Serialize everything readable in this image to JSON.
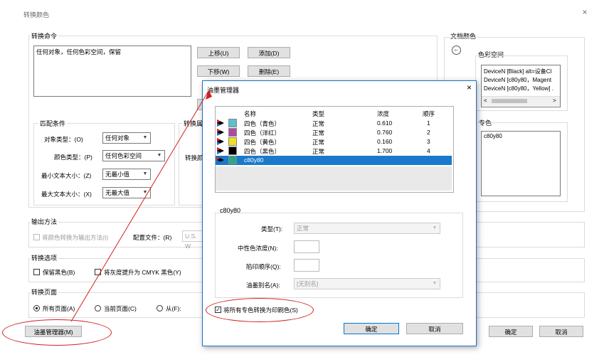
{
  "window": {
    "title": "转换颜色",
    "close_glyph": "×"
  },
  "commands": {
    "group_label": "转换命令",
    "list_items": [
      "任何对象，任何色彩空间，保留"
    ],
    "move_up": "上移(U)",
    "add": "添加(D)",
    "move_down": "下移(W)",
    "delete": "删除(E)"
  },
  "match": {
    "group_label": "匹配条件",
    "object_type_label": "对象类型：(O)",
    "object_type_value": "任何对象",
    "color_type_label": "颜色类型：(P)",
    "color_type_value": "任何色彩空间",
    "min_text_label": "最小文本大小：(Z)",
    "min_text_value": "无最小值",
    "max_text_label": "最大文本大小：(X)",
    "max_text_value": "无最大值"
  },
  "convert_partial": {
    "group_label": "转换属",
    "row_label": "转换颜"
  },
  "output": {
    "group_label": "输出方法",
    "convert_checkbox_label": "将颜色转换为输出方法(I)",
    "profile_label": "配置文件：(R)",
    "profile_value": "U.S. W"
  },
  "convert_options": {
    "group_label": "转换选项",
    "preserve_black": "保留黑色(B)",
    "promote_gray": "将灰度提升为 CMYK 黑色(Y)"
  },
  "convert_pages": {
    "group_label": "转换页面",
    "all_pages": "所有页面(A)",
    "current_page": "当前页面(C)",
    "from": "从(F):"
  },
  "ink_manager_button": "油墨管理器(M)",
  "doc_colors": {
    "group_label": "文档颜色",
    "colorspace_label": "色彩空间",
    "colorspace_items": [
      "DeviceN [Black] alt=设备Cl",
      "DeviceN [c80y80，Magent",
      "DeviceN [c80y80，Yellow] ."
    ],
    "spot_label": "专色",
    "spot_items": [
      "c80y80"
    ]
  },
  "main_buttons": {
    "ok": "确定",
    "cancel": "取消"
  },
  "ink_dialog": {
    "title": "油墨管理器",
    "close_glyph": "×",
    "columns": [
      "名称",
      "类型",
      "浓度",
      "顺序"
    ],
    "rows": [
      {
        "name": "四色（青色）",
        "type": "正常",
        "density": "0.610",
        "order": "1",
        "swatch": "#5bc0d0"
      },
      {
        "name": "四色（洋红）",
        "type": "正常",
        "density": "0.760",
        "order": "2",
        "swatch": "#b04aa0"
      },
      {
        "name": "四色（黄色）",
        "type": "正常",
        "density": "0.160",
        "order": "3",
        "swatch": "#f0e020"
      },
      {
        "name": "四色（黑色）",
        "type": "正常",
        "density": "1.700",
        "order": "4",
        "swatch": "#000000"
      },
      {
        "name": "c80y80",
        "type": "",
        "density": "",
        "order": "",
        "swatch": "#2aa888"
      }
    ],
    "detail_group_label": "c80y80",
    "type_label": "类型(T):",
    "type_value": "正常",
    "neutral_density_label": "中性色浓度(N):",
    "trap_order_label": "陷印顺序(Q):",
    "ink_alias_label": "油墨别名(A):",
    "ink_alias_value": "[无别名]",
    "convert_spot_checkbox": "将所有专色转换为印刷色(S)",
    "ok": "确定",
    "cancel": "取消"
  },
  "colors": {
    "accent_blue": "#1979ca",
    "callout_red": "#d02020"
  }
}
